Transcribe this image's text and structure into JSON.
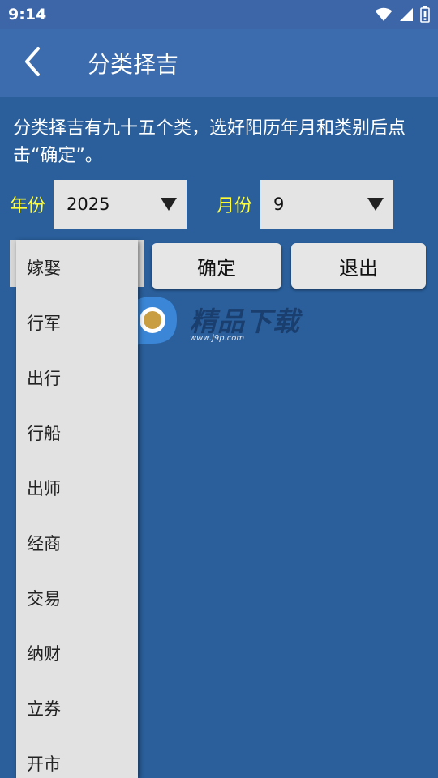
{
  "status_bar": {
    "time": "9:14",
    "icons": [
      "wifi-icon",
      "signal-icon",
      "battery-icon"
    ]
  },
  "app_bar": {
    "back_icon": "chevron-left-icon",
    "title": "分类择吉"
  },
  "intro_text": "分类择吉有九十五个类，选好阳历年月和类别后点击“确定”。",
  "year": {
    "label": "年份",
    "value": "2025"
  },
  "month": {
    "label": "月份",
    "value": "9"
  },
  "buttons": {
    "confirm": "确定",
    "exit": "退出"
  },
  "categories": [
    "嫁娶",
    "行军",
    "出行",
    "行船",
    "出师",
    "经商",
    "交易",
    "纳财",
    "立券",
    "开市"
  ],
  "watermark": {
    "text": "精品下载",
    "url": "www.j9p.com"
  },
  "colors": {
    "background": "#2a5f9c",
    "app_bar": "#3d6cae",
    "status_bar": "#3c66a8",
    "label_yellow": "#fffc3a",
    "control_gray": "#e4e4e4"
  }
}
